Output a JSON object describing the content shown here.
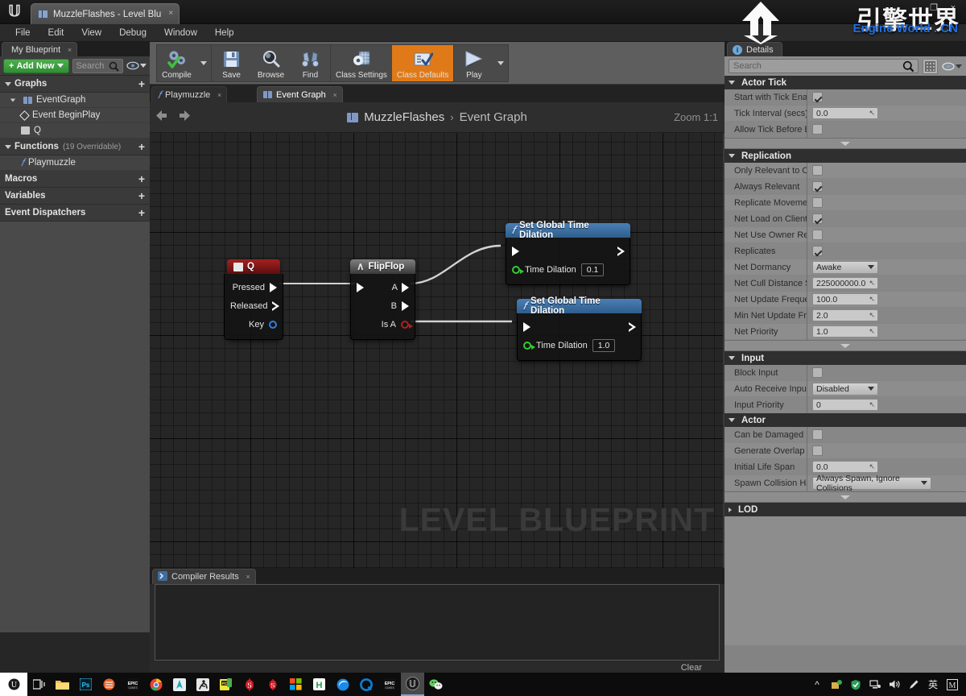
{
  "window": {
    "tab_title": "MuzzleFlashes - Level Blu",
    "close_label": "×",
    "maximize_label": "❐",
    "minimize_label": "–"
  },
  "menubar": {
    "items": [
      "File",
      "Edit",
      "View",
      "Debug",
      "Window",
      "Help"
    ]
  },
  "my_blueprint": {
    "tab_label": "My Blueprint",
    "add_new_label": "Add New",
    "search_placeholder": "Search",
    "sections": [
      {
        "label": "Graphs",
        "sub": "",
        "items": [
          {
            "label": "EventGraph",
            "icon": "graph-icon",
            "indent": 0
          },
          {
            "label": "Event BeginPlay",
            "icon": "event-icon",
            "indent": 1
          },
          {
            "label": "Q",
            "icon": "key-icon",
            "indent": 1
          }
        ]
      },
      {
        "label": "Functions",
        "sub": "(19 Overridable)",
        "items": [
          {
            "label": "Playmuzzle",
            "icon": "function-icon",
            "indent": 1
          }
        ]
      },
      {
        "label": "Macros",
        "sub": "",
        "items": []
      },
      {
        "label": "Variables",
        "sub": "",
        "items": []
      },
      {
        "label": "Event Dispatchers",
        "sub": "",
        "items": []
      }
    ]
  },
  "toolbar": {
    "buttons": [
      {
        "label": "Compile",
        "icon": "compile-gears-icon",
        "has_caret": true,
        "active": false
      },
      {
        "label": "Save",
        "icon": "floppy-disk-icon",
        "has_caret": false,
        "active": false
      },
      {
        "label": "Browse",
        "icon": "magnifier-icon",
        "has_caret": false,
        "active": false
      },
      {
        "label": "Find",
        "icon": "binoculars-icon",
        "has_caret": false,
        "active": false
      },
      {
        "label": "Class Settings",
        "icon": "gear-grid-icon",
        "has_caret": false,
        "active": false
      },
      {
        "label": "Class Defaults",
        "icon": "checklist-icon",
        "has_caret": false,
        "active": true
      },
      {
        "label": "Play",
        "icon": "play-triangle-icon",
        "has_caret": true,
        "active": false
      }
    ]
  },
  "graph": {
    "tabs": [
      {
        "label": "Playmuzzle",
        "icon": "function-icon",
        "active": false
      },
      {
        "label": "Event Graph",
        "icon": "graph-icon",
        "active": true
      }
    ],
    "breadcrumb_root": "MuzzleFlashes",
    "breadcrumb_sep": "›",
    "breadcrumb_current": "Event Graph",
    "zoom_label": "Zoom 1:1",
    "watermark": "LEVEL BLUEPRINT",
    "back_arrow": "⬅",
    "forward_arrow": "➡",
    "nodes": {
      "q_event": {
        "title": "Q",
        "pins": [
          "Pressed",
          "Released",
          "Key"
        ]
      },
      "flipflop": {
        "title": "FlipFlop",
        "out_a": "A",
        "out_b": "B",
        "out_isa": "Is A"
      },
      "set_time_dilation_a": {
        "title": "Set Global Time Dilation",
        "param_label": "Time Dilation",
        "param_value": "0.1"
      },
      "set_time_dilation_b": {
        "title": "Set Global Time Dilation",
        "param_label": "Time Dilation",
        "param_value": "1.0"
      }
    }
  },
  "compiler": {
    "tab_label": "Compiler Results",
    "clear_label": "Clear",
    "messages": []
  },
  "details": {
    "tab_label": "Details",
    "search_placeholder": "Search",
    "categories": [
      {
        "name": "Actor Tick",
        "collapsed": false,
        "rows": [
          {
            "label": "Start with Tick Enab",
            "type": "checkbox",
            "value": true
          },
          {
            "label": "Tick Interval (secs)",
            "type": "number",
            "value": "0.0"
          },
          {
            "label": "Allow Tick Before Bе",
            "type": "checkbox",
            "value": false
          }
        ],
        "has_expander": true
      },
      {
        "name": "Replication",
        "collapsed": false,
        "rows": [
          {
            "label": "Only Relevant to Ow",
            "type": "checkbox",
            "value": false
          },
          {
            "label": "Always Relevant",
            "type": "checkbox",
            "value": true
          },
          {
            "label": "Replicate Movemen",
            "type": "checkbox",
            "value": false
          },
          {
            "label": "Net Load on Client",
            "type": "checkbox",
            "value": true
          },
          {
            "label": "Net Use Owner Rele",
            "type": "checkbox",
            "value": false
          },
          {
            "label": "Replicates",
            "type": "checkbox",
            "value": true
          },
          {
            "label": "Net Dormancy",
            "type": "combo",
            "value": "Awake"
          },
          {
            "label": "Net Cull Distance Sq",
            "type": "number",
            "value": "225000000.0"
          },
          {
            "label": "Net Update Frequen",
            "type": "number",
            "value": "100.0"
          },
          {
            "label": "Min Net Update Freq",
            "type": "number",
            "value": "2.0"
          },
          {
            "label": "Net Priority",
            "type": "number",
            "value": "1.0"
          }
        ],
        "has_expander": true
      },
      {
        "name": "Input",
        "collapsed": false,
        "rows": [
          {
            "label": "Block Input",
            "type": "checkbox",
            "value": false
          },
          {
            "label": "Auto Receive Input",
            "type": "combo",
            "value": "Disabled"
          },
          {
            "label": "Input Priority",
            "type": "number",
            "value": "0"
          }
        ],
        "has_expander": false
      },
      {
        "name": "Actor",
        "collapsed": false,
        "rows": [
          {
            "label": "Can be Damaged",
            "type": "checkbox",
            "value": false
          },
          {
            "label": "Generate Overlap Ev",
            "type": "checkbox",
            "value": false
          },
          {
            "label": "Initial Life Span",
            "type": "number",
            "value": "0.0"
          },
          {
            "label": "Spawn Collision Har",
            "type": "combo-wide",
            "value": "Always Spawn, Ignore Collisions"
          }
        ],
        "has_expander": true
      },
      {
        "name": "LOD",
        "collapsed": true,
        "rows": [],
        "has_expander": false
      }
    ]
  },
  "watermark_logo": {
    "chinese": "引擎世界",
    "english": "Engine World . CN"
  },
  "taskbar": {
    "left_icons": [
      "task-view-icon",
      "file-explorer-icon",
      "photoshop-icon",
      "audio-app-icon",
      "epic-games-icon",
      "chrome-icon",
      "unreal-teal-icon",
      "runner-icon",
      "pc-app-icon",
      "s-red-icon",
      "s-red2-icon",
      "microsoft-store-icon",
      "h-green-icon",
      "edge-icon",
      "q-blue-icon",
      "epic-games2-icon",
      "unreal-icon",
      "wechat-icon"
    ],
    "tray_icons": [
      "chevron-up-icon",
      "notification-icon",
      "shield-icon",
      "network-icon",
      "volume-icon",
      "pen-icon"
    ],
    "tray_lang": "英",
    "tray_ime": "M"
  },
  "colors": {
    "accent_orange": "#e07a18",
    "add_new_green": "#3f9e3f",
    "exec_white": "#ffffff",
    "data_green": "#33cc33",
    "event_red": "#a42020",
    "function_blue": "#4a7fb5",
    "link_blue": "#1f6fe0"
  }
}
